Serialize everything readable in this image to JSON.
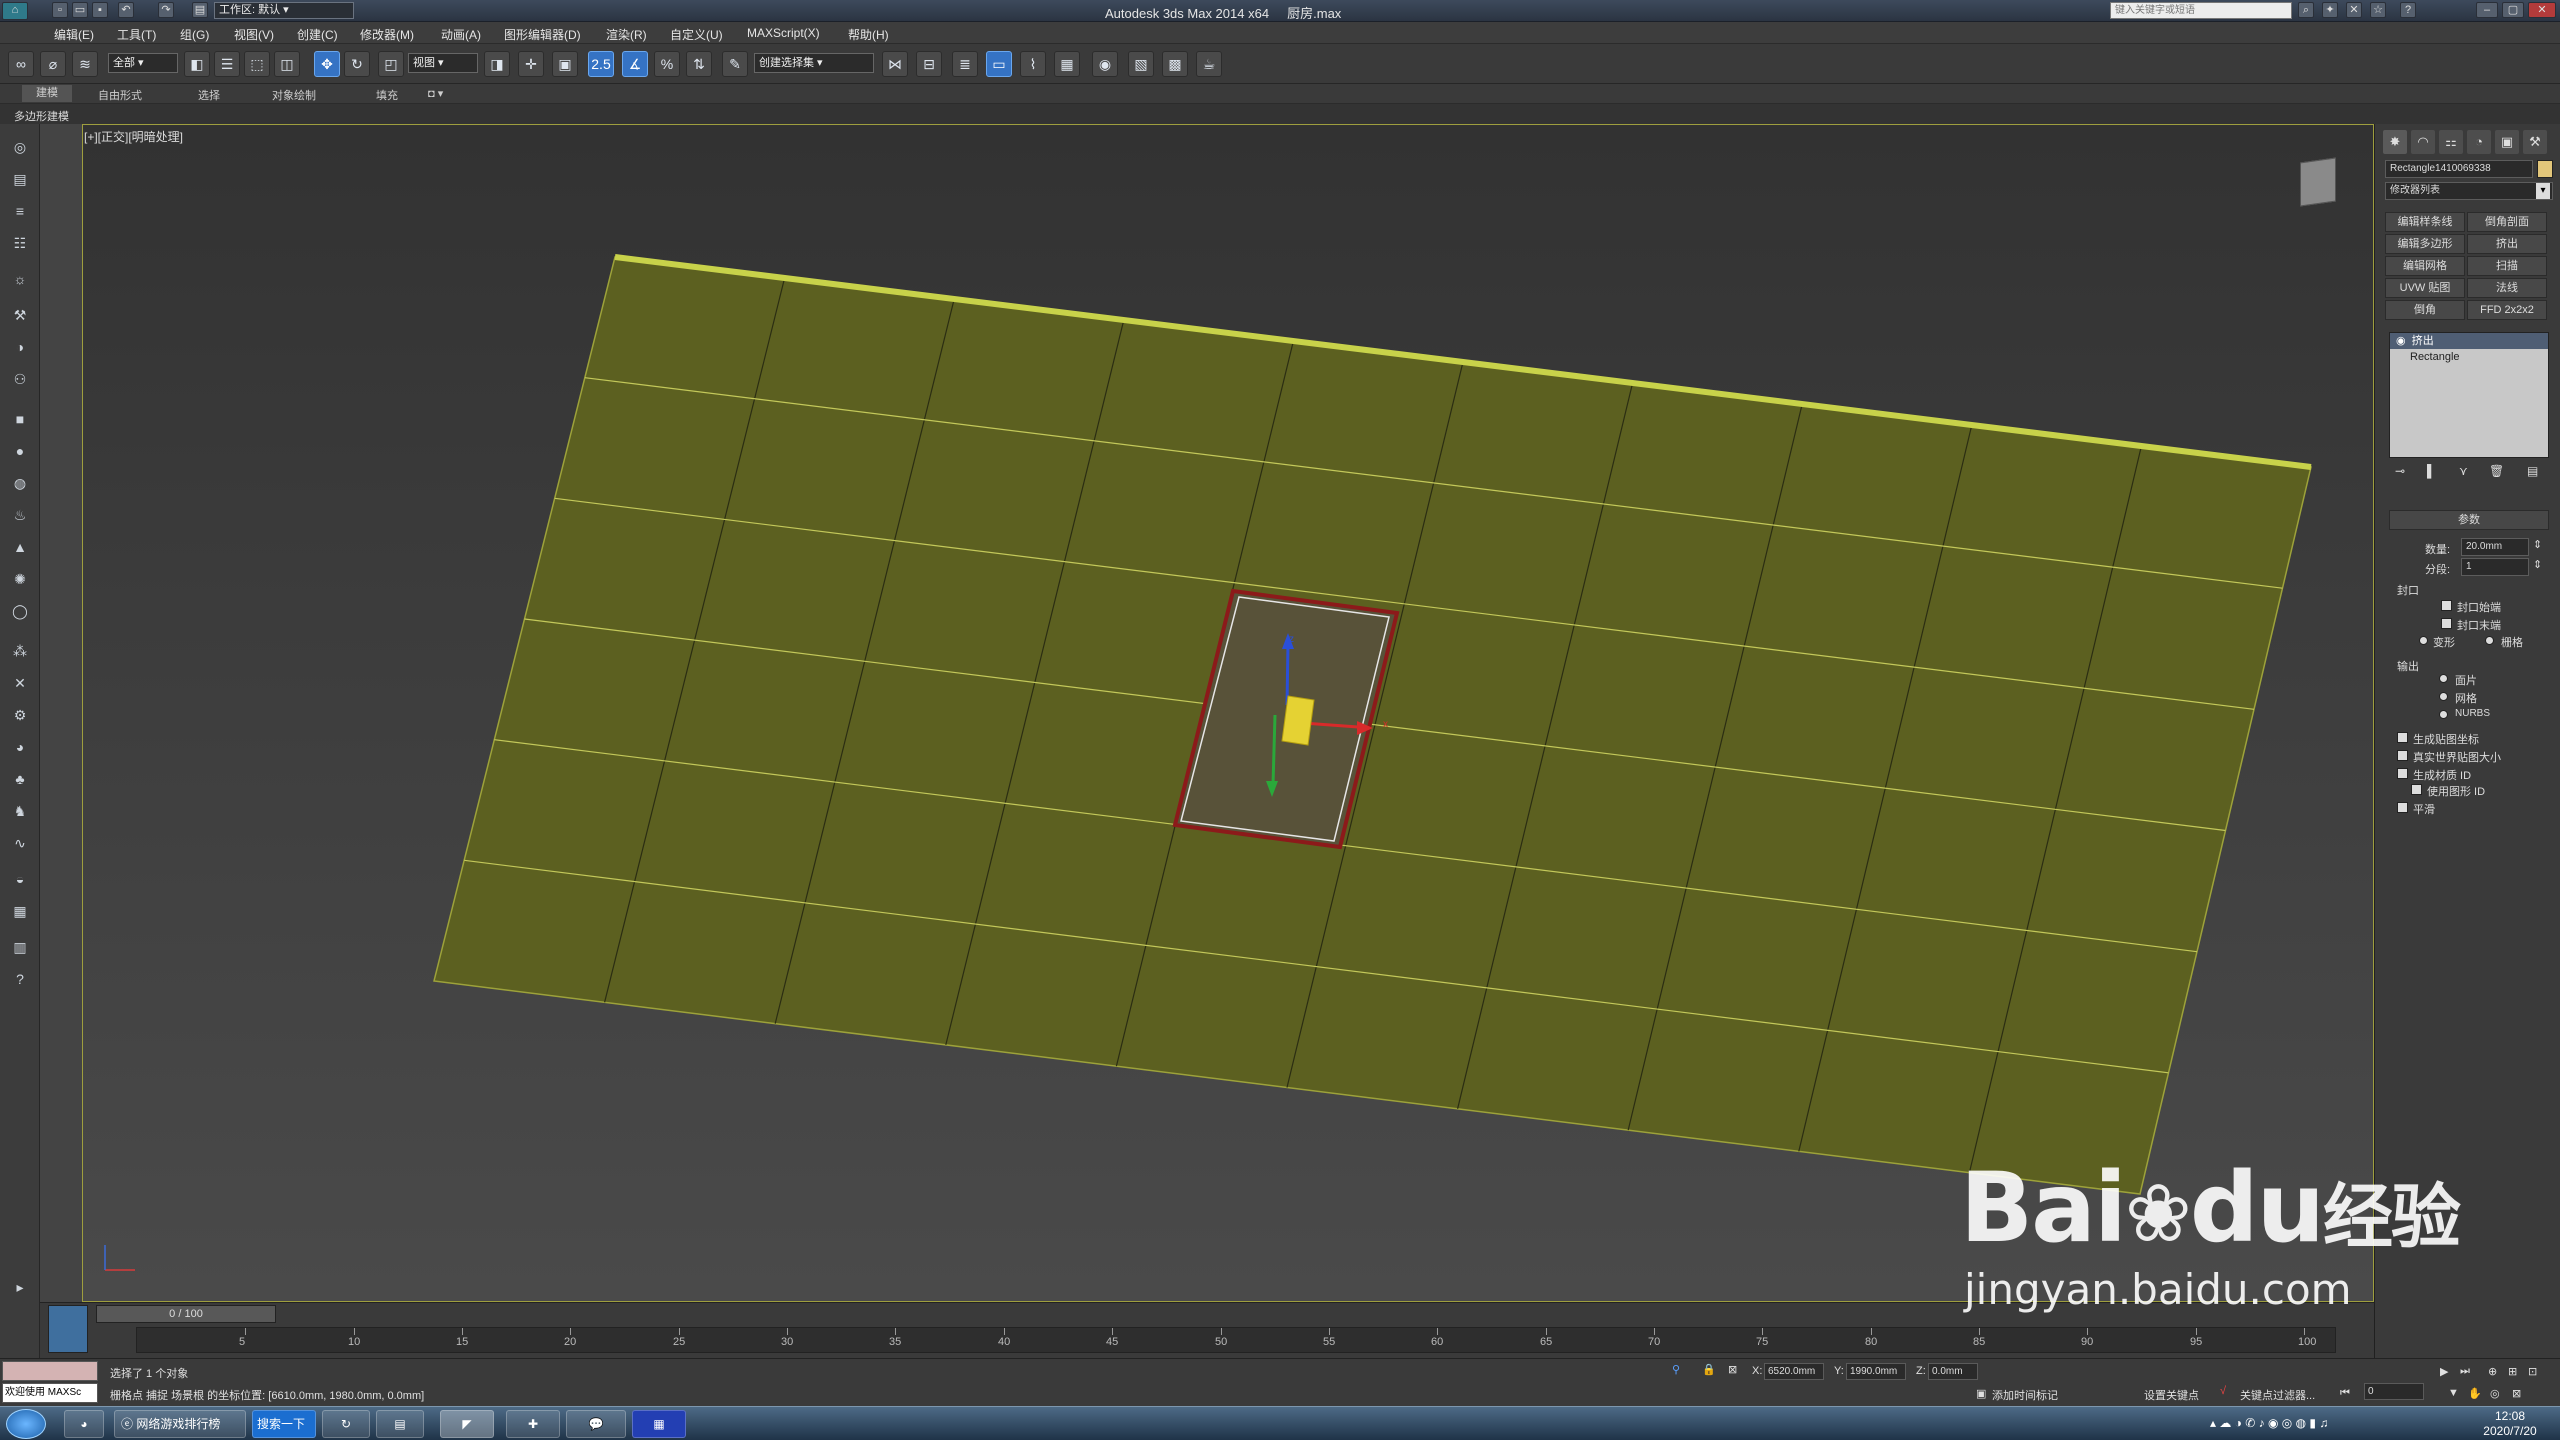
{
  "window": {
    "title": "Autodesk 3ds Max  2014 x64",
    "filename": "厨房.max",
    "workspace": "工作区: 默认",
    "search_placeholder": "键入关键字或短语"
  },
  "menu": [
    "编辑(E)",
    "工具(T)",
    "组(G)",
    "视图(V)",
    "创建(C)",
    "修改器(M)",
    "动画(A)",
    "图形编辑器(D)",
    "渲染(R)",
    "自定义(U)",
    "MAXScript(X)",
    "帮助(H)"
  ],
  "toolbar": {
    "selection_filter": "全部",
    "ref_coord": "视图",
    "named_selection": "创建选择集",
    "snap_label": "2.5"
  },
  "ribbon": {
    "tabs": [
      "建模",
      "自由形式",
      "选择",
      "对象绘制",
      "填充"
    ],
    "panel_label": "多边形建模"
  },
  "viewport": {
    "label": "[+][正交][明暗处理]",
    "gizmo_axis_x": "x",
    "gizmo_axis_z": "z"
  },
  "command_panel": {
    "object_name": "Rectangle1410069338",
    "object_color": "#e2c67a",
    "modifier_list": "修改器列表",
    "modifier_buttons": [
      "编辑样条线",
      "倒角剖面",
      "编辑多边形",
      "挤出",
      "编辑网格",
      "扫描",
      "UVW 贴图",
      "法线",
      "倒角",
      "FFD 2x2x2"
    ],
    "stack": [
      "挤出",
      "Rectangle"
    ],
    "rollout_title": "参数",
    "amount_label": "数量:",
    "amount_value": "20.0mm",
    "segments_label": "分段:",
    "segments_value": "1",
    "capping_label": "封口",
    "cap_start": "封口始端",
    "cap_end": "封口末端",
    "morph": "变形",
    "grid": "栅格",
    "output_label": "输出",
    "out_patch": "面片",
    "out_mesh": "网格",
    "out_nurbs": "NURBS",
    "gen_map": "生成贴图坐标",
    "real_world": "真实世界贴图大小",
    "gen_mat": "生成材质 ID",
    "use_shape": "使用图形 ID",
    "smooth": "平滑"
  },
  "timeline": {
    "frame": "0 / 100",
    "ticks": [
      "5",
      "10",
      "15",
      "20",
      "25",
      "30",
      "35",
      "40",
      "45",
      "50",
      "55",
      "60",
      "65",
      "70",
      "75",
      "80",
      "85",
      "90",
      "95",
      "100"
    ]
  },
  "status": {
    "maxscript": "欢迎使用 MAXSc",
    "selection": "选择了 1 个对象",
    "prompt": "栅格点 捕捉 场景根 的坐标位置: [6610.0mm, 1980.0mm, 0.0mm]",
    "x_label": "X:",
    "x_value": "6520.0mm",
    "y_label": "Y:",
    "y_value": "1990.0mm",
    "z_label": "Z:",
    "z_value": "0.0mm",
    "add_tag": "添加时间标记",
    "set_key": "设置关键点",
    "key_filter": "关键点过滤器...",
    "frame_field": "0"
  },
  "taskbar": {
    "tasks": [
      "网络游戏排行榜",
      "搜索一下"
    ],
    "time": "12:08",
    "date": "2020/7/20"
  },
  "watermark": {
    "brand": "Bai",
    "brand2": "du",
    "cn": "经验",
    "url": "jingyan.baidu.com"
  }
}
